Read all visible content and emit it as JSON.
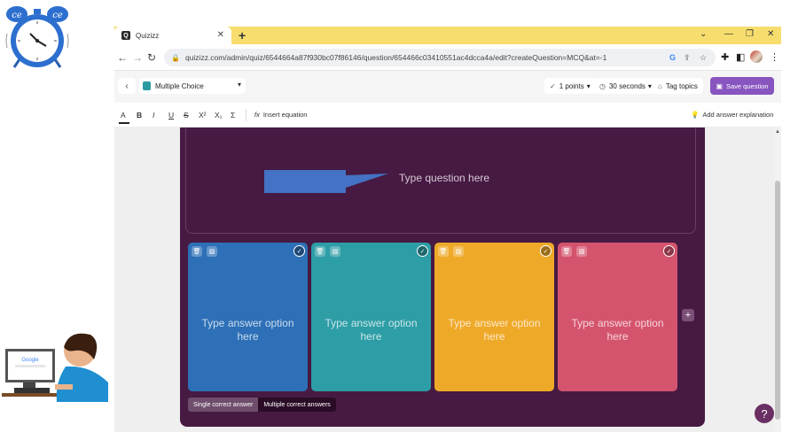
{
  "browser": {
    "tab_title": "Quizizz",
    "tab_logo": "Q",
    "url": "quizizz.com/admin/quiz/6544664a87f930bc07f86146/question/654466c03410551ac4dcca4a/edit?createQuestion=MCQ&at=-1"
  },
  "editor": {
    "question_type": "Multiple Choice",
    "points_label": "1 points",
    "time_label": "30 seconds",
    "tag_label": "Tag topics",
    "save_label": "Save question"
  },
  "toolbar": {
    "text_color": "A",
    "bold": "B",
    "italic": "I",
    "underline": "U",
    "strike": "S",
    "superscript": "X²",
    "subscript": "X₁",
    "sigma": "Σ",
    "insert_equation": "Insert equation",
    "add_explanation": "Add answer explanation"
  },
  "question": {
    "placeholder": "Type question here"
  },
  "answers": [
    {
      "text": "Type answer option here",
      "color": "#2d70b7"
    },
    {
      "text": "Type answer option here",
      "color": "#2d9da6"
    },
    {
      "text": "Type answer option here",
      "color": "#efa929"
    },
    {
      "text": "Type answer option here",
      "color": "#d5546d"
    }
  ],
  "answer_mode": {
    "single": "Single correct answer",
    "multiple": "Multiple correct answers"
  },
  "help": "?",
  "colors": {
    "panel": "#461a42",
    "accent": "#8854c0",
    "tabbar": "#f7dd6d"
  }
}
